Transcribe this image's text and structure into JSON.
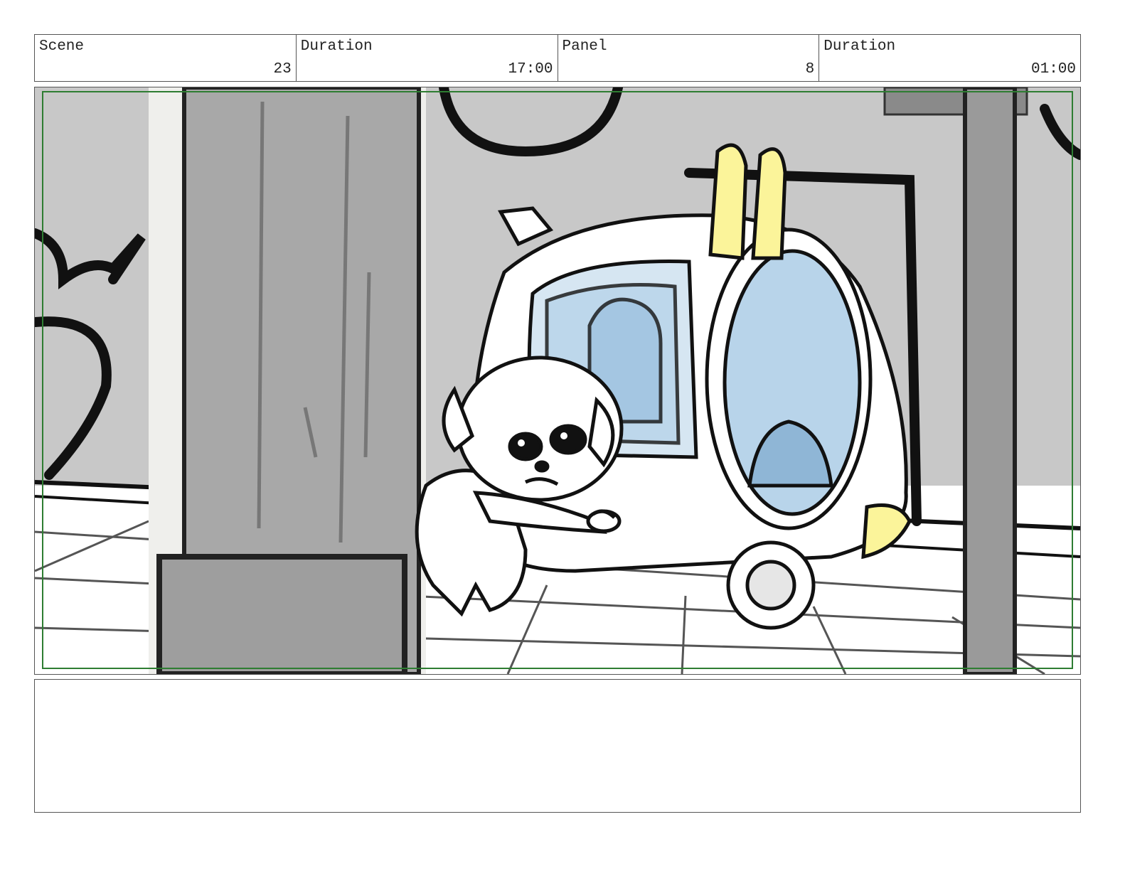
{
  "header": {
    "scene_label": "Scene",
    "scene_value": "23",
    "scene_duration_label": "Duration",
    "scene_duration_value": "17:00",
    "panel_label": "Panel",
    "panel_value": "8",
    "panel_duration_label": "Duration",
    "panel_duration_value": "01:00"
  },
  "notes": {
    "text": ""
  },
  "colors": {
    "frame_guide": "#2e7d32",
    "wall": "#c8c8c8",
    "pillar": "#a8a8a8",
    "glass": "#b8d4ea",
    "accent_yellow": "#fbf49a"
  }
}
